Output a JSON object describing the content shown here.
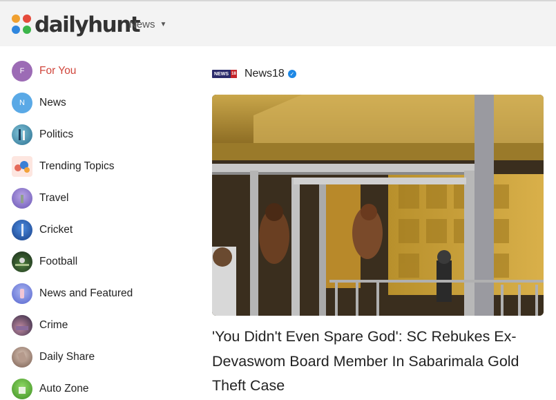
{
  "header": {
    "logo_text": "dailyhunt",
    "nav_label": "News",
    "nav_caret": "▼"
  },
  "sidebar": {
    "items": [
      {
        "label": "For You",
        "icon_letter": "F",
        "icon": "letter-f-icon",
        "color": "#9c6bb5",
        "active": true
      },
      {
        "label": "News",
        "icon_letter": "N",
        "icon": "letter-n-icon",
        "color": "#5aa9e6",
        "active": false
      },
      {
        "label": "Politics",
        "icon_letter": "",
        "icon": "politics-icon",
        "color": "#3a8fb5",
        "active": false
      },
      {
        "label": "Trending Topics",
        "icon_letter": "",
        "icon": "trending-topics-icon",
        "color": "#e76b6b",
        "active": false
      },
      {
        "label": "Travel",
        "icon_letter": "",
        "icon": "travel-icon",
        "color": "#8d77c9",
        "active": false
      },
      {
        "label": "Cricket",
        "icon_letter": "",
        "icon": "cricket-icon",
        "color": "#2a5db0",
        "active": false
      },
      {
        "label": "Football",
        "icon_letter": "",
        "icon": "football-icon",
        "color": "#2c4a2e",
        "active": false
      },
      {
        "label": "News and Featured",
        "icon_letter": "",
        "icon": "news-featured-icon",
        "color": "#7d8ee6",
        "active": false
      },
      {
        "label": "Crime",
        "icon_letter": "",
        "icon": "crime-icon",
        "color": "#4a3f66",
        "active": false
      },
      {
        "label": "Daily Share",
        "icon_letter": "",
        "icon": "daily-share-icon",
        "color": "#a58a7a",
        "active": false
      },
      {
        "label": "Auto Zone",
        "icon_letter": "",
        "icon": "auto-zone-icon",
        "color": "#5cb23a",
        "active": false
      }
    ]
  },
  "article": {
    "source_name": "News18",
    "source_logo_text": "NEWS",
    "source_logo_num": "18",
    "verified_mark": "✓",
    "image_alt": "Sabarimala temple golden sanctum",
    "headline": "'You Didn't Even Spare God': SC Rebukes Ex-Devaswom Board Member In Sabarimala Gold Theft Case"
  },
  "colors": {
    "active": "#d0453b",
    "header_bg": "#f3f3f3",
    "text": "#222222"
  }
}
